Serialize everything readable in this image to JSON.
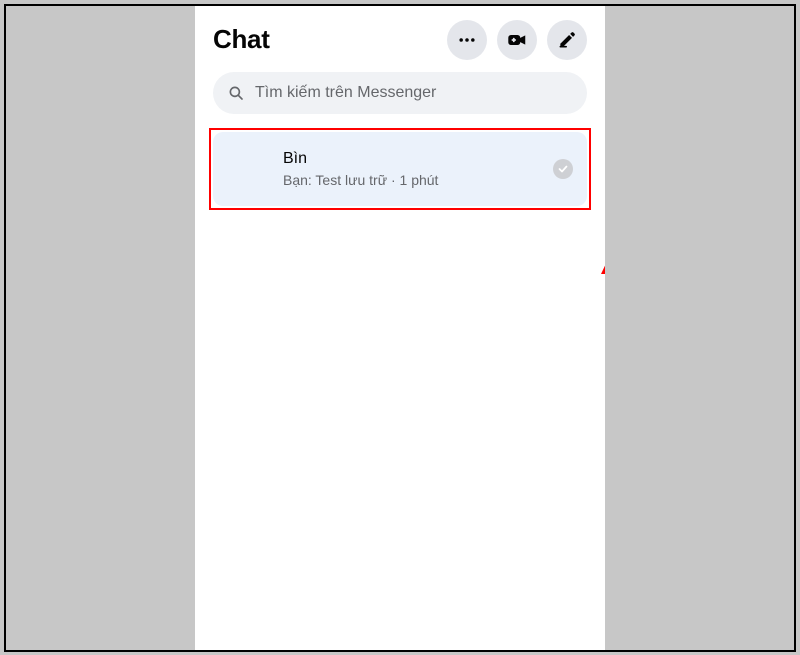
{
  "header": {
    "title": "Chat"
  },
  "search": {
    "placeholder": "Tìm kiếm trên Messenger"
  },
  "conversations": [
    {
      "name": "Bìn",
      "preview": "Bạn: Test lưu trữ · 1 phút"
    }
  ]
}
